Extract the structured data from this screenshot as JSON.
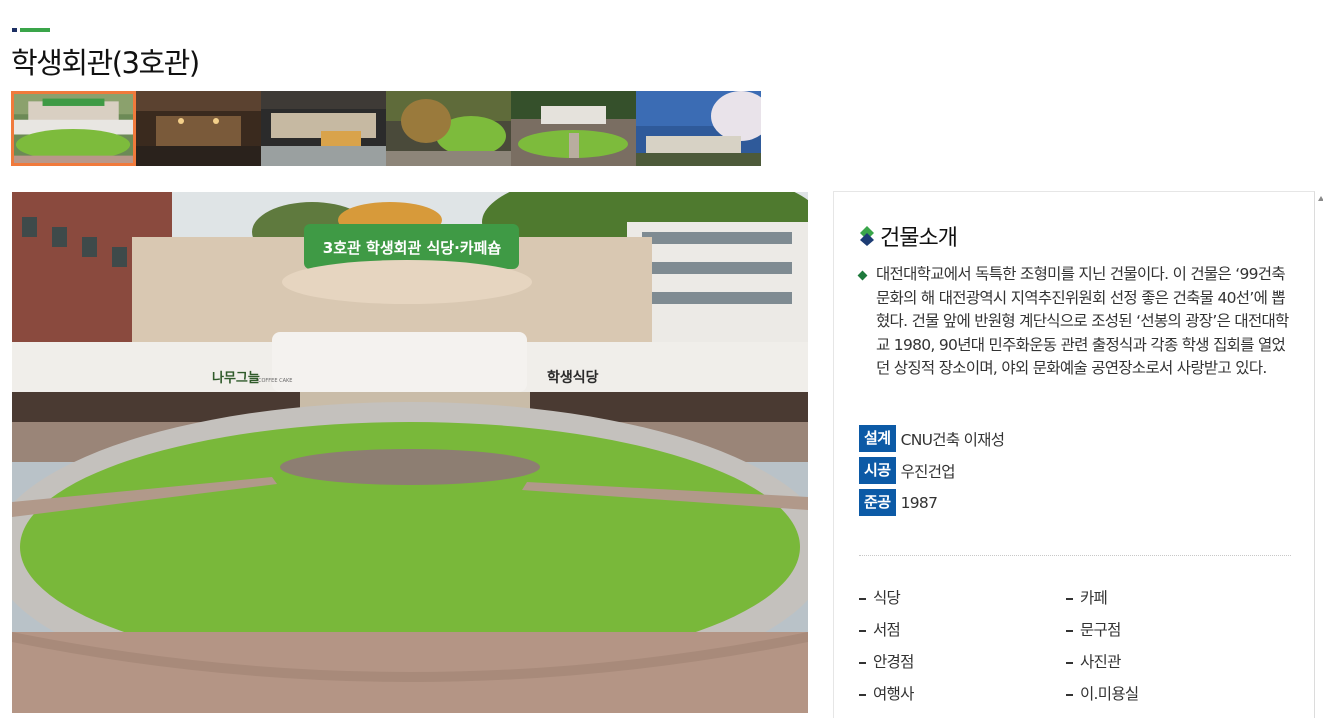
{
  "page": {
    "title": "학생회관(3호관)",
    "accent_colors": {
      "title_deco_dark": "#1d2f63",
      "title_deco_green": "#3aa54a",
      "thumb_active": "#f07a3c",
      "label_bg": "#0c5aa6"
    }
  },
  "gallery": {
    "selected_index": 0,
    "thumbnails": [
      {
        "name": "thumbnail-plaza-front"
      },
      {
        "name": "thumbnail-cafeteria-interior"
      },
      {
        "name": "thumbnail-lobby-interior"
      },
      {
        "name": "thumbnail-plaza-aerial"
      },
      {
        "name": "thumbnail-plaza-wide"
      },
      {
        "name": "thumbnail-cherry-blossom"
      }
    ]
  },
  "main_photo": {
    "sign_banner": "3호관 학생회관 식당·카페숍",
    "sign_left": "나무그늘",
    "sign_left_small": "COFFEE CAKE",
    "sign_right": "학생식당"
  },
  "info": {
    "section_title": "건물소개",
    "section_icon": "diamond-icon",
    "description": "대전대학교에서 독특한 조형미를 지닌 건물이다. 이 건물은 ‘99건축문화의 해 대전광역시 지역추진위원회 선정 좋은 건축물 40선’에 뽑혔다. 건물 앞에 반원형 계단식으로 조성된 ‘선봉의 광장’은 대전대학교 1980, 90년대 민주화운동 관련 출정식과 각종 학생 집회를 열었던 상징적 장소이며, 야외 문화예술 공연장소로서 사랑받고 있다.",
    "meta": [
      {
        "label": "설계",
        "value": "CNU건축 이재성"
      },
      {
        "label": "시공",
        "value": "우진건업"
      },
      {
        "label": "준공",
        "value": "1987"
      }
    ],
    "facilities": [
      "식당",
      "카페",
      "서점",
      "문구점",
      "안경점",
      "사진관",
      "여행사",
      "이.미용실"
    ]
  }
}
